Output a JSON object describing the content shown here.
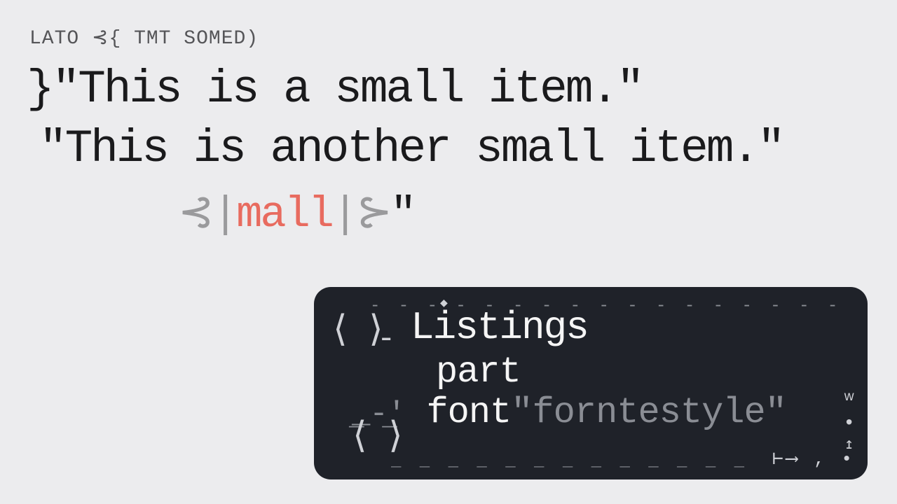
{
  "header": "LATO ⊰{ TMT SOMED)",
  "line1": "}\"This is a small item.\"",
  "line2": "\"This is another small item.\"",
  "line3": {
    "open": "⊰|",
    "word": "mall",
    "close": "|⊱",
    "quote": "\""
  },
  "code_panel": {
    "title": "Listings",
    "sub": "part",
    "font_key": "font",
    "font_val": "\"forntestyle\""
  }
}
